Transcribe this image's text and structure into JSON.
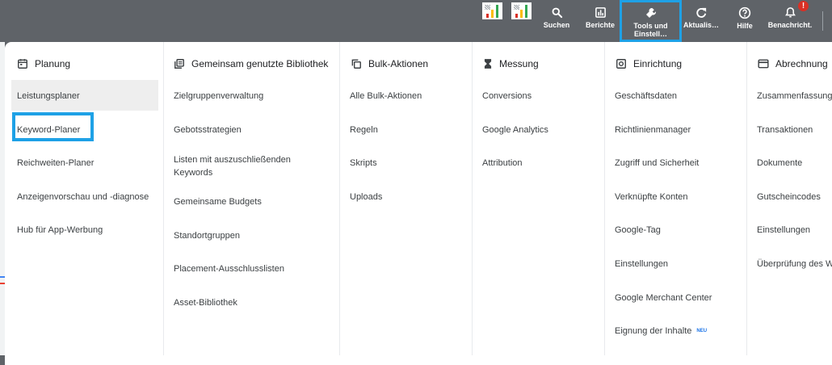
{
  "toolbar": {
    "widgets": [
      {
        "icon": "quality-score-chart-icon",
        "colors": [
          "#d93025",
          "#fbbc04",
          "#34a853"
        ]
      },
      {
        "icon": "quality-score-chart-icon",
        "colors": [
          "#d93025",
          "#fbbc04",
          "#34a853"
        ]
      }
    ],
    "items": [
      {
        "id": "search",
        "label": "Suchen",
        "icon": "search-icon"
      },
      {
        "id": "reports",
        "label": "Berichte",
        "icon": "reports-icon"
      },
      {
        "id": "tools",
        "label_line1": "Tools und",
        "label_line2": "Einstell…",
        "icon": "wrench-icon",
        "active": true
      },
      {
        "id": "refresh",
        "label": "Aktualis…",
        "icon": "refresh-icon"
      },
      {
        "id": "help",
        "label": "Hilfe",
        "icon": "help-icon"
      },
      {
        "id": "notifications",
        "label": "Benachricht.",
        "icon": "bell-icon",
        "badge": "!"
      }
    ],
    "highlight_color": "#1ea1e6",
    "badge_color": "#d93025"
  },
  "menu": {
    "columns": [
      {
        "id": "planung",
        "title": "Planung",
        "icon": "calendar-icon",
        "items": [
          "Leistungsplaner",
          "Keyword-Planer",
          "Reichweiten-Planer",
          "Anzeigenvorschau und -diagnose",
          "Hub für App-Werbung"
        ],
        "hovered": "Leistungsplaner",
        "outlined": "Keyword-Planer"
      },
      {
        "id": "bibliothek",
        "title": "Gemeinsam genutzte Bibliothek",
        "icon": "library-icon",
        "items": [
          "Zielgruppenverwaltung",
          "Gebotsstrategien",
          "Listen mit auszuschließenden Keywords",
          "Gemeinsame Budgets",
          "Standortgruppen",
          "Placement-Ausschlusslisten",
          "Asset-Bibliothek"
        ]
      },
      {
        "id": "bulk",
        "title": "Bulk-Aktionen",
        "icon": "copy-icon",
        "items": [
          "Alle Bulk-Aktionen",
          "Regeln",
          "Skripts",
          "Uploads"
        ]
      },
      {
        "id": "messung",
        "title": "Messung",
        "icon": "hourglass-icon",
        "items": [
          "Conversions",
          "Google Analytics",
          "Attribution"
        ]
      },
      {
        "id": "einrichtung",
        "title": "Einrichtung",
        "icon": "settings-box-icon",
        "items": [
          "Geschäftsdaten",
          "Richtlinienmanager",
          "Zugriff und Sicherheit",
          "Verknüpfte Konten",
          "Google-Tag",
          "Einstellungen",
          "Google Merchant Center",
          "Eignung der Inhalte"
        ],
        "new_badge": "NEU"
      },
      {
        "id": "abrechnung",
        "title": "Abrechnung",
        "icon": "credit-card-icon",
        "items": [
          "Zusammenfassung",
          "Transaktionen",
          "Dokumente",
          "Gutscheincodes",
          "Einstellungen",
          "Überprüfung des W"
        ]
      }
    ]
  }
}
